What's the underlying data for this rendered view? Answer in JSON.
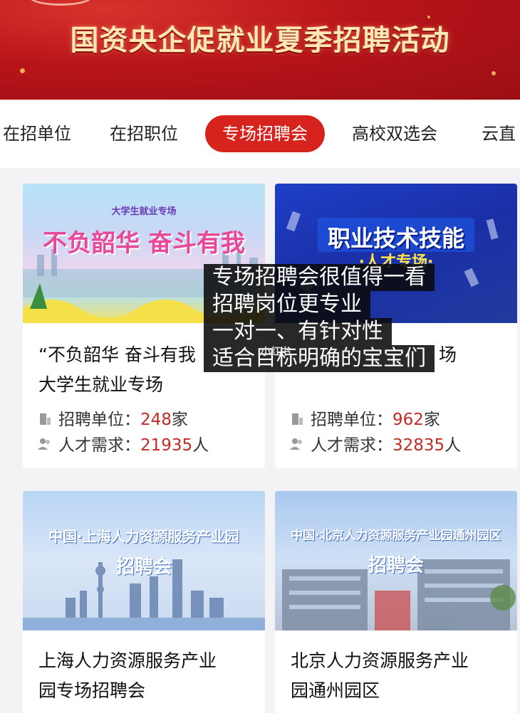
{
  "banner": {
    "title": "国资央企促就业夏季招聘活动"
  },
  "tabs": [
    {
      "label": "在招单位"
    },
    {
      "label": "在招职位"
    },
    {
      "label": "专场招聘会"
    },
    {
      "label": "高校双选会"
    },
    {
      "label": "云直"
    }
  ],
  "active_tab": "专场招聘会",
  "cards": [
    {
      "poster": {
        "headline": "不负韶华 奋斗有我",
        "sub": "大学生就业专场"
      },
      "title": "“不负韶华 奋斗有我”大学生就业专场",
      "title_line1": "“不负韶华 奋斗有我",
      "title_line2": "大学生就业专场",
      "units_label": "招聘单位：",
      "units_value": "248",
      "units_suffix": "家",
      "demand_label": "人才需求：",
      "demand_value": "21935",
      "demand_suffix": "人"
    },
    {
      "poster": {
        "headline": "职业技术技能",
        "sub": "·人才专场·"
      },
      "title_fragment": "场",
      "units_label": "招聘单位：",
      "units_value": "962",
      "units_suffix": "家",
      "demand_label": "人才需求：",
      "demand_value": "32835",
      "demand_suffix": "人"
    },
    {
      "poster": {
        "headline": "中国·上海人力资源服务产业园",
        "sub": "招聘会"
      },
      "title_line1": "上海人力资源服务产业",
      "title_line2": "园专场招聘会"
    },
    {
      "poster": {
        "headline": "中国·北京人力资源服务产业园通州园区",
        "sub": "招聘会"
      },
      "title_line1": "北京人力资源服务产业",
      "title_line2": "园通州园区"
    }
  ],
  "overlay_caption": {
    "lines": [
      "专场招聘会很值得一看",
      "招聘岗位更专业",
      "一对一、有针对性",
      "适合目标明确的宝宝们"
    ],
    "watermark": "小红书"
  },
  "colors": {
    "accent": "#d6231d",
    "number": "#c22b25",
    "banner_text": "#fde7b3"
  }
}
